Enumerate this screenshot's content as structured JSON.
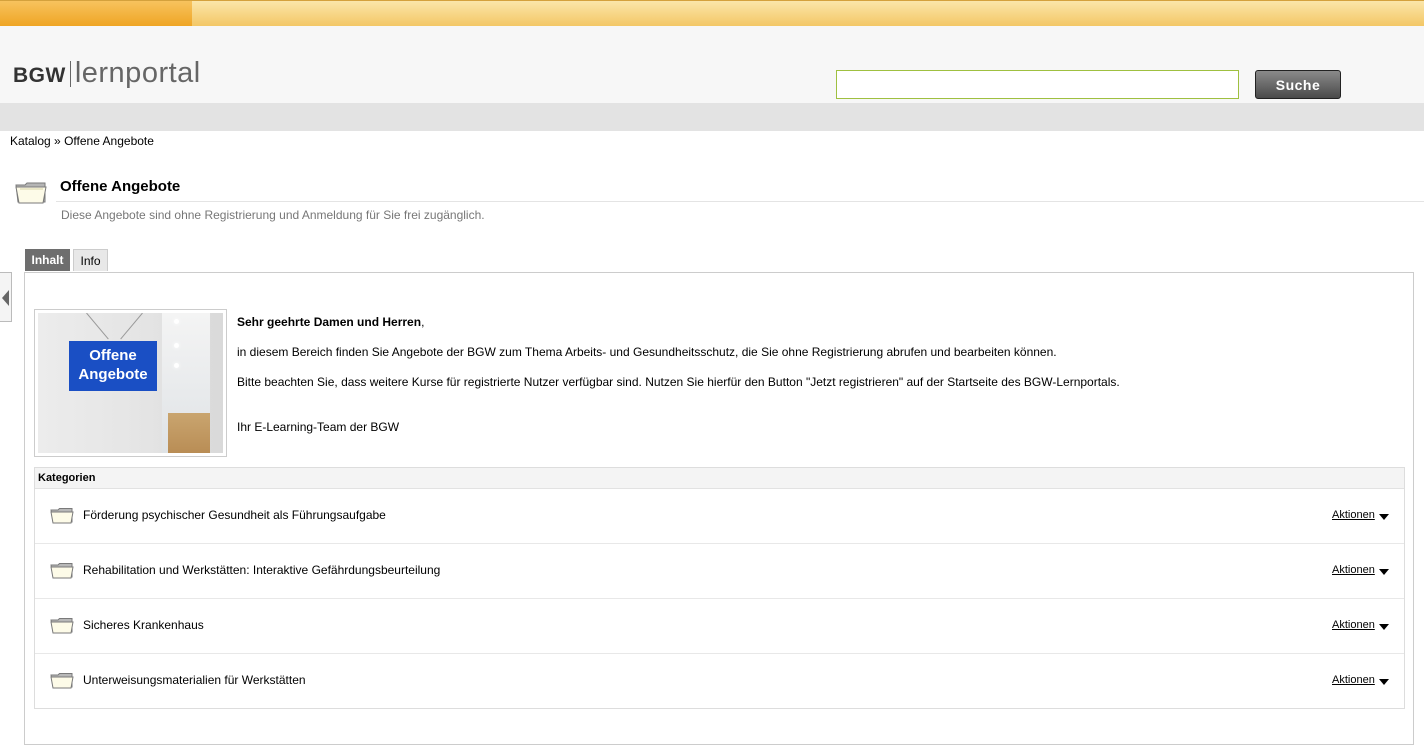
{
  "header": {
    "logo_brand": "BGW",
    "logo_name": "lernportal",
    "search_value": "",
    "search_button": "Suche"
  },
  "breadcrumb": {
    "root": "Katalog",
    "separator": "»",
    "current": "Offene Angebote"
  },
  "page": {
    "title": "Offene Angebote",
    "subtitle": "Diese Angebote sind ohne Registrierung und Anmeldung für Sie frei zugänglich."
  },
  "tabs": [
    {
      "label": "Inhalt",
      "active": true
    },
    {
      "label": "Info",
      "active": false
    }
  ],
  "teaser": {
    "sign_line1": "Offene",
    "sign_line2": "Angebote",
    "greeting": "Sehr geehrte Damen und Herren",
    "greeting_punct": ",",
    "paragraph1": "in diesem Bereich finden Sie Angebote der BGW zum Thema Arbeits- und Gesundheitsschutz, die Sie ohne Registrierung abrufen und bearbeiten können.",
    "paragraph2": "Bitte beachten Sie, dass weitere Kurse für registrierte Nutzer verfügbar sind. Nutzen Sie hierfür den Button \"Jetzt registrieren\" auf der Startseite des BGW-Lernportals.",
    "signature": "Ihr E-Learning-Team der BGW"
  },
  "categories": {
    "header": "Kategorien",
    "items": [
      {
        "label": "Förderung psychischer Gesundheit als Führungsaufgabe",
        "actions": "Aktionen"
      },
      {
        "label": "Rehabilitation und Werkstätten: Interaktive Gefährdungsbeurteilung",
        "actions": "Aktionen"
      },
      {
        "label": "Sicheres Krankenhaus",
        "actions": "Aktionen"
      },
      {
        "label": "Unterweisungsmaterialien für Werkstätten",
        "actions": "Aktionen"
      }
    ]
  },
  "colors": {
    "accent_orange": "#efa524",
    "search_border": "#9fc040",
    "sign_blue": "#1a4fc4"
  }
}
